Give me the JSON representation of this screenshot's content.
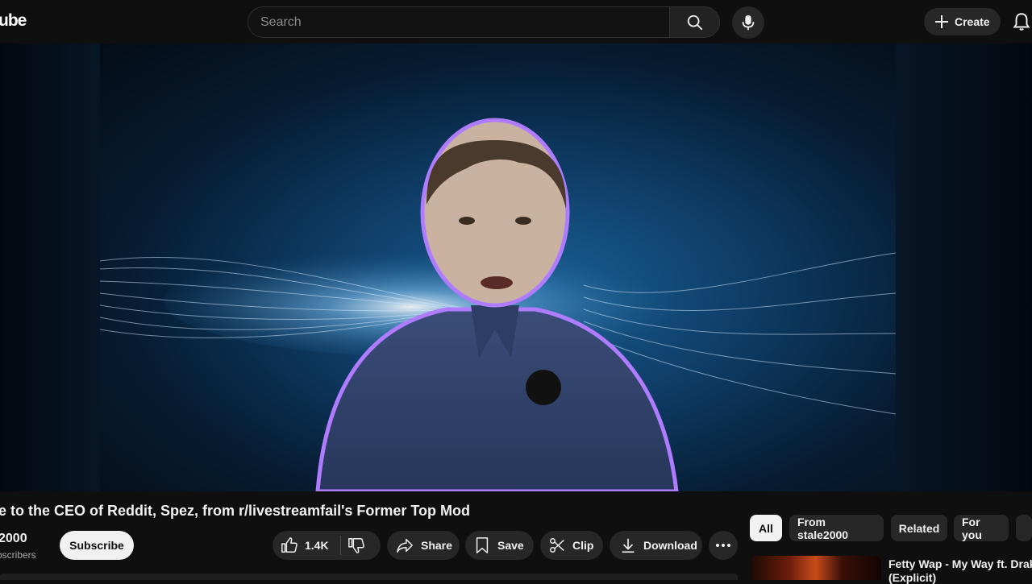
{
  "header": {
    "logo_text": "ube",
    "search_placeholder": "Search",
    "create_label": "Create",
    "icons": [
      "search-icon",
      "mic-icon",
      "plus-icon",
      "bell-icon"
    ]
  },
  "video": {
    "title": "e to the CEO of Reddit, Spez, from r/livestreamfail's Former Top Mod"
  },
  "channel": {
    "name": "2000",
    "subscribers": "bscribers",
    "subscribe_label": "Subscribe"
  },
  "actions": {
    "like_count": "1.4K",
    "share_label": "Share",
    "save_label": "Save",
    "clip_label": "Clip",
    "download_label": "Download"
  },
  "chips": [
    "All",
    "From stale2000",
    "Related",
    "For you"
  ],
  "recommendation": {
    "title_line1": "Fetty Wap - My Way ft. Drake",
    "title_line2": "(Explicit)"
  },
  "colors": {
    "background": "#0f0f0f",
    "pill": "#272727",
    "text": "#f1f1f1",
    "secondary_text": "#aaaaaa",
    "video_glow": "#a06bff"
  }
}
